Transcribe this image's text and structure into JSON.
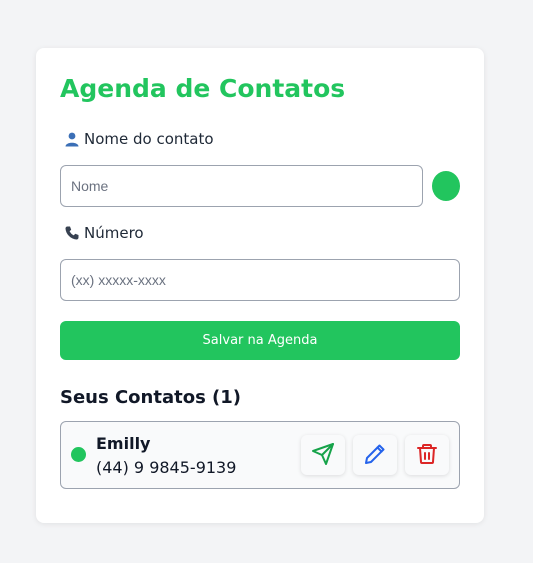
{
  "app": {
    "title": "Agenda de Contatos"
  },
  "form": {
    "name_label": "Nome do contato",
    "name_placeholder": "Nome",
    "name_value": "",
    "number_label": "Número",
    "number_placeholder": "(xx) xxxxx-xxxx",
    "number_value": "",
    "selected_color": "#22c55e",
    "save_label": "Salvar na Agenda"
  },
  "contacts_section": {
    "title": "Seus Contatos (1)",
    "items": [
      {
        "name": "Emilly",
        "phone": "(44) 9 9845-9139",
        "color": "#22c55e",
        "actions": [
          "send-icon",
          "pencil-icon",
          "trash-icon"
        ]
      }
    ]
  },
  "colors": {
    "accent": "#22c55e",
    "send": "#16a34a",
    "edit": "#2563eb",
    "delete": "#dc2626"
  }
}
